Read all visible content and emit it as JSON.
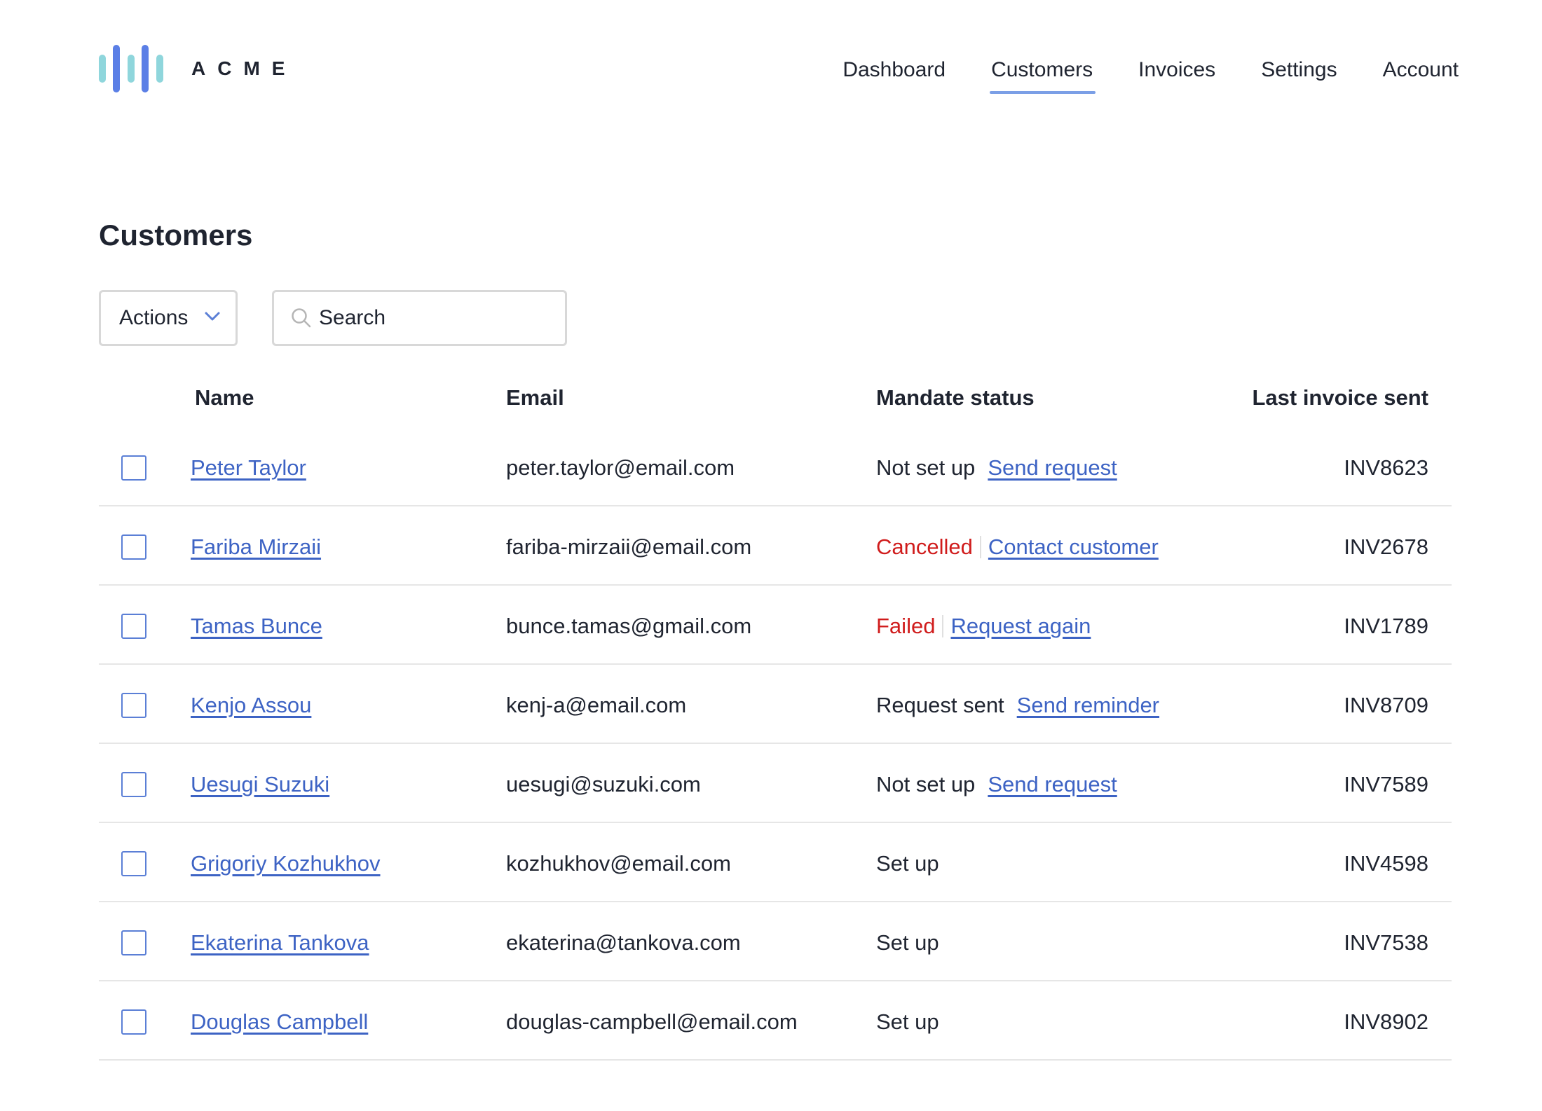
{
  "brand": {
    "name": "ACME",
    "colors": {
      "bar_light": "#8fd6dc",
      "bar_dark": "#5b7fe6"
    }
  },
  "nav": {
    "items": [
      {
        "label": "Dashboard",
        "active": false
      },
      {
        "label": "Customers",
        "active": true
      },
      {
        "label": "Invoices",
        "active": false
      },
      {
        "label": "Settings",
        "active": false
      },
      {
        "label": "Account",
        "active": false
      }
    ]
  },
  "page": {
    "title": "Customers"
  },
  "toolbar": {
    "actions_label": "Actions",
    "search_placeholder": "Search"
  },
  "table": {
    "headers": {
      "name": "Name",
      "email": "Email",
      "mandate": "Mandate status",
      "invoice": "Last invoice sent"
    },
    "rows": [
      {
        "name": "Peter Taylor",
        "email": "peter.taylor@email.com",
        "status": "Not set up",
        "status_type": "neutral",
        "action": "Send request",
        "invoice": "INV8623"
      },
      {
        "name": "Fariba Mirzaii",
        "email": "fariba-mirzaii@email.com",
        "status": "Cancelled",
        "status_type": "bad",
        "action": "Contact customer",
        "invoice": "INV2678"
      },
      {
        "name": "Tamas Bunce",
        "email": "bunce.tamas@gmail.com",
        "status": "Failed",
        "status_type": "bad",
        "action": "Request again",
        "invoice": "INV1789"
      },
      {
        "name": "Kenjo Assou",
        "email": "kenj-a@email.com",
        "status": "Request sent",
        "status_type": "neutral",
        "action": "Send reminder",
        "invoice": "INV8709"
      },
      {
        "name": "Uesugi Suzuki",
        "email": "uesugi@suzuki.com",
        "status": "Not set up",
        "status_type": "neutral",
        "action": "Send request",
        "invoice": "INV7589"
      },
      {
        "name": "Grigoriy Kozhukhov",
        "email": "kozhukhov@email.com",
        "status": "Set up",
        "status_type": "neutral",
        "action": "",
        "invoice": "INV4598"
      },
      {
        "name": "Ekaterina Tankova",
        "email": "ekaterina@tankova.com",
        "status": "Set up",
        "status_type": "neutral",
        "action": "",
        "invoice": "INV7538"
      },
      {
        "name": "Douglas Campbell",
        "email": "douglas-campbell@email.com",
        "status": "Set up",
        "status_type": "neutral",
        "action": "",
        "invoice": "INV8902"
      }
    ]
  },
  "colors": {
    "link": "#3d63c4",
    "error": "#d01c1c",
    "nav_underline": "#7b9fe6",
    "border": "#d8d8d8"
  }
}
